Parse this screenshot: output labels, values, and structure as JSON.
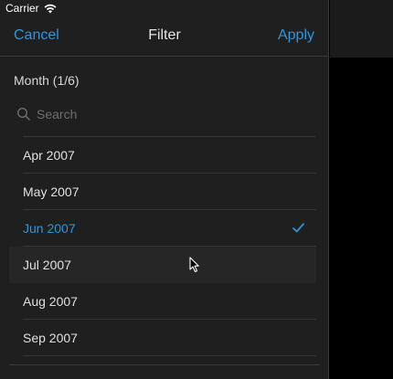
{
  "status_bar": {
    "carrier": "Carrier",
    "wifi_icon": "wifi-icon"
  },
  "nav": {
    "cancel_label": "Cancel",
    "title": "Filter",
    "apply_label": "Apply"
  },
  "filter": {
    "section_label": "Month (1/6)",
    "search_placeholder": "Search",
    "search_value": ""
  },
  "months": [
    {
      "label": "Apr 2007",
      "selected": false
    },
    {
      "label": "May 2007",
      "selected": false
    },
    {
      "label": "Jun 2007",
      "selected": true
    },
    {
      "label": "Jul 2007",
      "selected": false,
      "hovered": true
    },
    {
      "label": "Aug 2007",
      "selected": false
    },
    {
      "label": "Sep 2007",
      "selected": false
    }
  ],
  "colors": {
    "accent": "#2f95dc",
    "panel_bg": "#1f1f1f",
    "text": "#e0e0e0"
  },
  "icons": {
    "search": "search-icon",
    "check": "checkmark-icon",
    "cursor": "mouse-cursor-icon"
  }
}
